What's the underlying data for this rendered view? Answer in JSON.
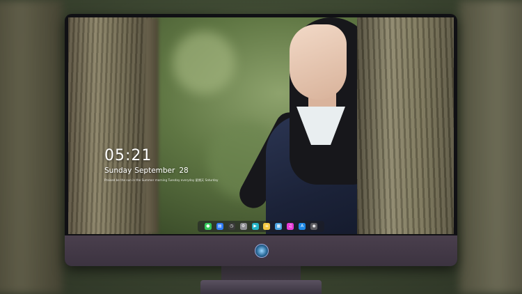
{
  "lockscreen": {
    "time": "05:21",
    "weekday": "Sunday",
    "month": "September",
    "day": "28",
    "subtext": "Praised be the sun in the Summer morning Tuesday everyday 星期天 Saturday"
  },
  "dock": {
    "items": [
      {
        "name": "messages-icon",
        "glyph": "●",
        "color": "#34c759"
      },
      {
        "name": "files-icon",
        "glyph": "▤",
        "color": "#2f7bf5"
      },
      {
        "name": "clock-icon",
        "glyph": "◷",
        "color": "#3a3a3a"
      },
      {
        "name": "settings-icon",
        "glyph": "⚙",
        "color": "#8e8e93"
      },
      {
        "name": "clapper-icon",
        "glyph": "▶",
        "color": "#24b3c6"
      },
      {
        "name": "notes-icon",
        "glyph": "≡",
        "color": "#f5c842"
      },
      {
        "name": "photos-icon",
        "glyph": "▦",
        "color": "#4aa3df"
      },
      {
        "name": "music-icon",
        "glyph": "♫",
        "color": "#e63bd6"
      },
      {
        "name": "app-store-icon",
        "glyph": "A",
        "color": "#1e88e5"
      },
      {
        "name": "camera-icon",
        "glyph": "◉",
        "color": "#5b5b60"
      }
    ]
  }
}
